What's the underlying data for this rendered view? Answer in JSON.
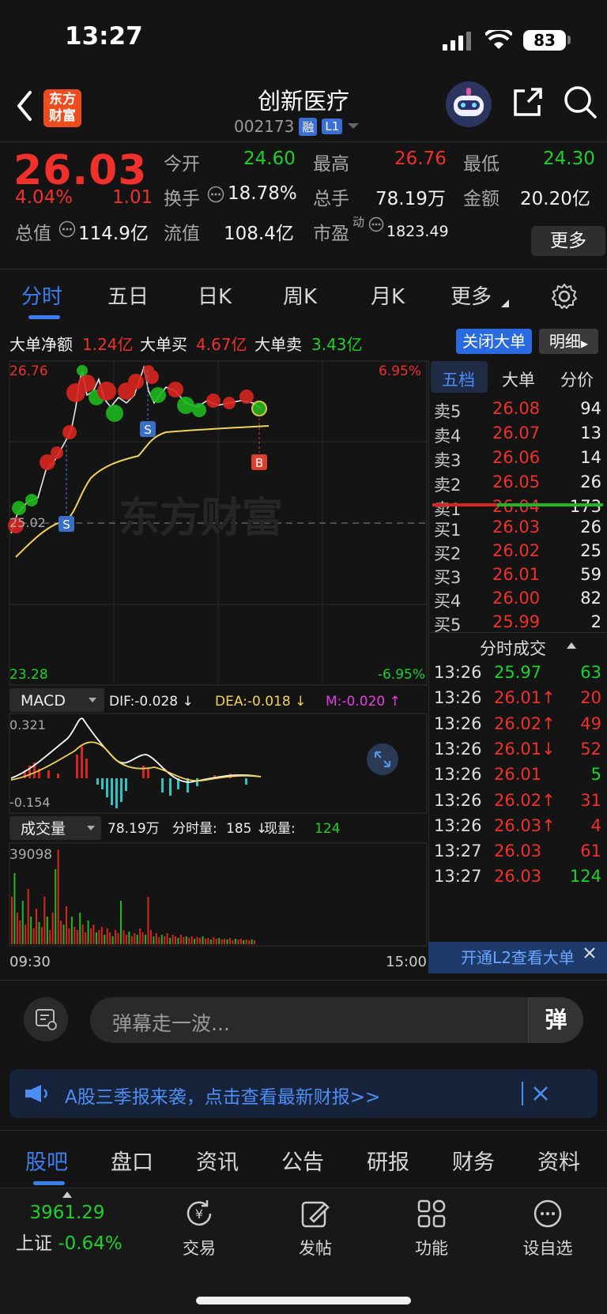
{
  "status_bar": {
    "time": "13:27",
    "battery": "83"
  },
  "header": {
    "logo": "东方财富",
    "stock_name": "创新医疗",
    "stock_code": "002173",
    "tag_margin": "融",
    "tag_level": "L1"
  },
  "quote": {
    "price": "26.03",
    "change_pct": "4.04%",
    "change": "1.01",
    "items": {
      "open_label": "今开",
      "open": "24.60",
      "high_label": "最高",
      "high": "26.76",
      "low_label": "最低",
      "low": "24.30",
      "turnover_label": "换手",
      "turnover": "18.78%",
      "volume_label": "总手",
      "volume": "78.19万",
      "amount_label": "金额",
      "amount": "20.20亿",
      "mktcap_label": "总值",
      "mktcap": "114.9亿",
      "float_label": "流值",
      "float": "108.4亿",
      "pe_label": "市盈",
      "pe_sup": "动",
      "pe": "1823.49"
    },
    "more_label": "更多"
  },
  "chart_tabs": [
    "分时",
    "五日",
    "日K",
    "周K",
    "月K",
    "更多"
  ],
  "big_order": {
    "net_label": "大单净额",
    "net": "1.24亿",
    "buy_label": "大单买",
    "buy": "4.67亿",
    "sell_label": "大单卖",
    "sell": "3.43亿",
    "close_label": "关闭大单",
    "detail_label": "明细"
  },
  "intraday": {
    "price_high": "26.76",
    "price_low": "23.28",
    "pct_high": "6.95%",
    "pct_low": "-6.95%",
    "prev_close": "25.02",
    "watermark": "东方财富",
    "time_start": "09:30",
    "time_end": "15:00"
  },
  "macd": {
    "label": "MACD",
    "dif": "DIF:-0.028 ↓",
    "dea": "DEA:-0.018 ↓",
    "m": "M:-0.020 ↑",
    "top": "0.321",
    "bottom": "-0.154"
  },
  "volume": {
    "label": "成交量",
    "total": "78.19万",
    "tick_label": "分时量:",
    "tick": "185 ↓",
    "now_label": "现量:",
    "now": "124",
    "max": "39098"
  },
  "order_book": {
    "tabs": [
      "五档",
      "大单",
      "分价"
    ],
    "asks": [
      {
        "label": "卖5",
        "price": "26.08",
        "qty": "94"
      },
      {
        "label": "卖4",
        "price": "26.07",
        "qty": "13"
      },
      {
        "label": "卖3",
        "price": "26.06",
        "qty": "14"
      },
      {
        "label": "卖2",
        "price": "26.05",
        "qty": "26"
      },
      {
        "label": "卖1",
        "price": "26.04",
        "qty": "173"
      }
    ],
    "bids": [
      {
        "label": "买1",
        "price": "26.03",
        "qty": "26"
      },
      {
        "label": "买2",
        "price": "26.02",
        "qty": "25"
      },
      {
        "label": "买3",
        "price": "26.01",
        "qty": "59"
      },
      {
        "label": "买4",
        "price": "26.00",
        "qty": "82"
      },
      {
        "label": "买5",
        "price": "25.99",
        "qty": "2"
      }
    ],
    "trades_title": "分时成交",
    "trades": [
      {
        "time": "13:26",
        "price": "25.97",
        "qty": "63",
        "price_color": "#1dd12d",
        "qty_color": "#1dd12d"
      },
      {
        "time": "13:26",
        "price": "26.01↑",
        "qty": "20",
        "price_color": "#f0312b",
        "qty_color": "#f0312b"
      },
      {
        "time": "13:26",
        "price": "26.02↑",
        "qty": "49",
        "price_color": "#f0312b",
        "qty_color": "#f0312b"
      },
      {
        "time": "13:26",
        "price": "26.01↓",
        "qty": "52",
        "price_color": "#f0312b",
        "qty_color": "#f0312b"
      },
      {
        "time": "13:26",
        "price": "26.01",
        "qty": "5",
        "price_color": "#f0312b",
        "qty_color": "#1dd12d"
      },
      {
        "time": "13:26",
        "price": "26.02↑",
        "qty": "31",
        "price_color": "#f0312b",
        "qty_color": "#f0312b"
      },
      {
        "time": "13:26",
        "price": "26.03↑",
        "qty": "4",
        "price_color": "#f0312b",
        "qty_color": "#f0312b"
      },
      {
        "time": "13:27",
        "price": "26.03",
        "qty": "61",
        "price_color": "#f0312b",
        "qty_color": "#f0312b"
      },
      {
        "time": "13:27",
        "price": "26.03",
        "qty": "124",
        "price_color": "#f0312b",
        "qty_color": "#1dd12d"
      }
    ],
    "l2_label": "开通L2查看大单"
  },
  "danmaku": {
    "placeholder": "弹幕走一波...",
    "send": "弹"
  },
  "banner": {
    "text": "A股三季报来袭，点击查看最新财报>>"
  },
  "bottom_tabs": [
    "股吧",
    "盘口",
    "资讯",
    "公告",
    "研报",
    "财务",
    "资料"
  ],
  "navbar": {
    "index_value": "3961.29",
    "index_name": "上证",
    "index_change": "-0.64%",
    "items": [
      "交易",
      "发帖",
      "功能",
      "设自选"
    ]
  },
  "colors": {
    "up": "#f0312b",
    "down": "#1dd12d",
    "accent": "#3b7ef0",
    "avg_line": "#f2d35a"
  }
}
